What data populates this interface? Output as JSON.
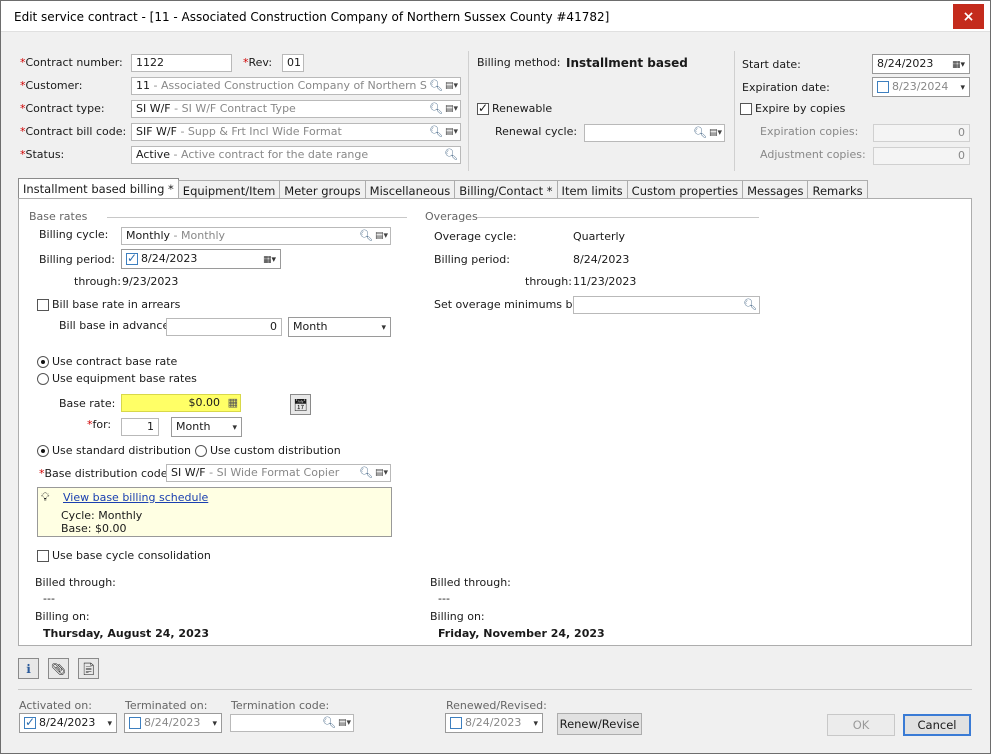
{
  "window": {
    "title": "Edit service contract - [11 - Associated Construction Company of Northern Sussex County #41782]",
    "close_label": "×"
  },
  "header": {
    "contract_number_label": "Contract number:",
    "contract_number": "1122",
    "rev_label": "Rev:",
    "rev": "01",
    "customer_label": "Customer:",
    "customer_code": "11",
    "customer_desc": "- Associated Construction Company of Northern Sussex County",
    "contract_type_label": "Contract type:",
    "contract_type_code": "SI W/F",
    "contract_type_desc": "- SI W/F  Contract Type",
    "bill_code_label": "Contract bill code:",
    "bill_code_code": "SIF W/F",
    "bill_code_desc": "- Supp & Frt Incl Wide Format",
    "status_label": "Status:",
    "status_code": "Active",
    "status_desc": "- Active contract for the date range",
    "billing_method_label": "Billing method:",
    "billing_method": "Installment based",
    "renewable_label": "Renewable",
    "renewal_cycle_label": "Renewal cycle:",
    "renewal_cycle": "",
    "start_date_label": "Start date:",
    "start_date": "8/24/2023",
    "expiration_date_label": "Expiration date:",
    "expiration_date": "8/23/2024",
    "expire_by_copies_label": "Expire by copies",
    "expiration_copies_label": "Expiration copies:",
    "expiration_copies": "0",
    "adjustment_copies_label": "Adjustment copies:",
    "adjustment_copies": "0"
  },
  "tabs": [
    {
      "label": "Installment based billing *"
    },
    {
      "label": "Equipment/Item"
    },
    {
      "label": "Meter groups"
    },
    {
      "label": "Miscellaneous"
    },
    {
      "label": "Billing/Contact *"
    },
    {
      "label": "Item limits"
    },
    {
      "label": "Custom properties"
    },
    {
      "label": "Messages"
    },
    {
      "label": "Remarks"
    }
  ],
  "base_rates": {
    "section_title": "Base rates",
    "billing_cycle_label": "Billing cycle:",
    "billing_cycle_code": "Monthly",
    "billing_cycle_desc": "- Monthly",
    "billing_period_label": "Billing period:",
    "billing_period": "8/24/2023",
    "through_label": "through:",
    "through": "9/23/2023",
    "arrears_label": "Bill base rate in arrears",
    "advance_label": "Bill base in advance:",
    "advance_value": "0",
    "advance_unit": "Month",
    "use_contract_rate_label": "Use contract base rate",
    "use_equipment_rates_label": "Use equipment base rates",
    "base_rate_label": "Base rate:",
    "base_rate": "$0.00",
    "for_label": "for:",
    "for_value": "1",
    "for_unit": "Month",
    "use_standard_dist_label": "Use standard distribution",
    "use_custom_dist_label": "Use custom distribution",
    "dist_code_label": "Base distribution code:",
    "dist_code": "SI W/F",
    "dist_desc": "- SI Wide Format Copier",
    "schedule_link": "View base billing schedule",
    "schedule_cycle": "Cycle: Monthly",
    "schedule_base": "Base: $0.00",
    "consolidation_label": "Use base cycle consolidation",
    "billed_through_label": "Billed through:",
    "billed_through": "---",
    "billing_on_label": "Billing on:",
    "billing_on": "Thursday, August 24, 2023"
  },
  "overages": {
    "section_title": "Overages",
    "cycle_label": "Overage cycle:",
    "cycle": "Quarterly",
    "billing_period_label": "Billing period:",
    "billing_period": "8/24/2023",
    "through_label": "through:",
    "through": "11/23/2023",
    "minimums_label": "Set overage minimums by:",
    "minimums": "",
    "billed_through_label": "Billed through:",
    "billed_through": "---",
    "billing_on_label": "Billing on:",
    "billing_on": "Friday, November 24, 2023"
  },
  "footer": {
    "activated_label": "Activated on:",
    "activated": "8/24/2023",
    "terminated_label": "Terminated on:",
    "terminated": "8/24/2023",
    "termination_code_label": "Termination code:",
    "termination_code": "",
    "renewed_label": "Renewed/Revised:",
    "renewed": "8/24/2023",
    "renew_button": "Renew/Revise",
    "ok_button": "OK",
    "cancel_button": "Cancel"
  }
}
